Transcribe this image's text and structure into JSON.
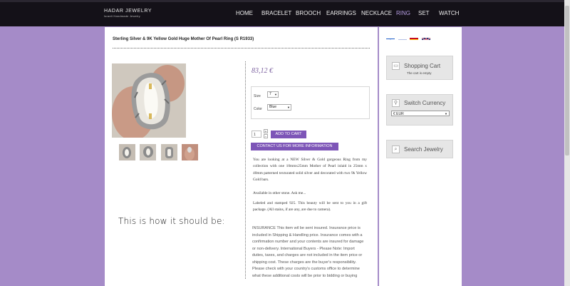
{
  "header": {
    "logo_name": "HADAR JEWELRY",
    "logo_tagline": "Israeli Handmade Jewelry",
    "nav": [
      "HOME",
      "BRACELET",
      "BROOCH",
      "EARRINGS",
      "NECKLACE",
      "RING",
      "SET",
      "WATCH"
    ],
    "active_nav": "RING"
  },
  "product": {
    "title": "Sterling Silver & 9K Yellow Gold Huge Mother Of Pearl Ring (S R1933)",
    "price": "83,12 €",
    "options": {
      "size_label": "Size",
      "size_value": "7",
      "color_label": "Color",
      "color_value": "Blue"
    },
    "quantity": "1",
    "add_to_cart_label": "ADD TO CART",
    "contact_label": "CONTACT US FOR MORE INFORMATION",
    "description": [
      "You are looking at a NEW Silver & Gold gorgeous Ring from my collection with one 10mmx25mm Mother of Pearl inlaid in 25mm x 40mm patterned texturated solid silver and decorated with two 9k Yellow Gold bars.",
      "Available in other stone. Ask me...",
      "Labeled and stamped 925. This beauty will be sent to you in a gift package. (All stains, if are any, are due to camera)."
    ],
    "insurance": "INSURANCE This item wil be sent insured. Insurance price is included in Shipping & Handling price. Insurance comes with a confirmation number and your contents are insured for damage or non-delivery. International Buyers - Please Note: Import duties, taxes, and charges are not included in the item price or shipping cost. These charges are the buyer's responsibility. Please check with your country's customs office to determine what these additional costs will be prior to bidding or buying"
  },
  "note": "This is how it should be:",
  "sidebar": {
    "flags": [
      "israel-flag",
      "russia-flag",
      "spain-flag",
      "uk-flag"
    ],
    "cart_title": "Shopping Cart",
    "cart_status": "The cart is empty",
    "currency_title": "Switch Currency",
    "currency_value": "€ EUR",
    "search_title": "Search Jewelry"
  },
  "colors": {
    "background": "#a58bc8",
    "topbar": "#141118",
    "accent_button": "#7d55b7",
    "price": "#7a5f9e",
    "active_nav": "#b59de0"
  }
}
